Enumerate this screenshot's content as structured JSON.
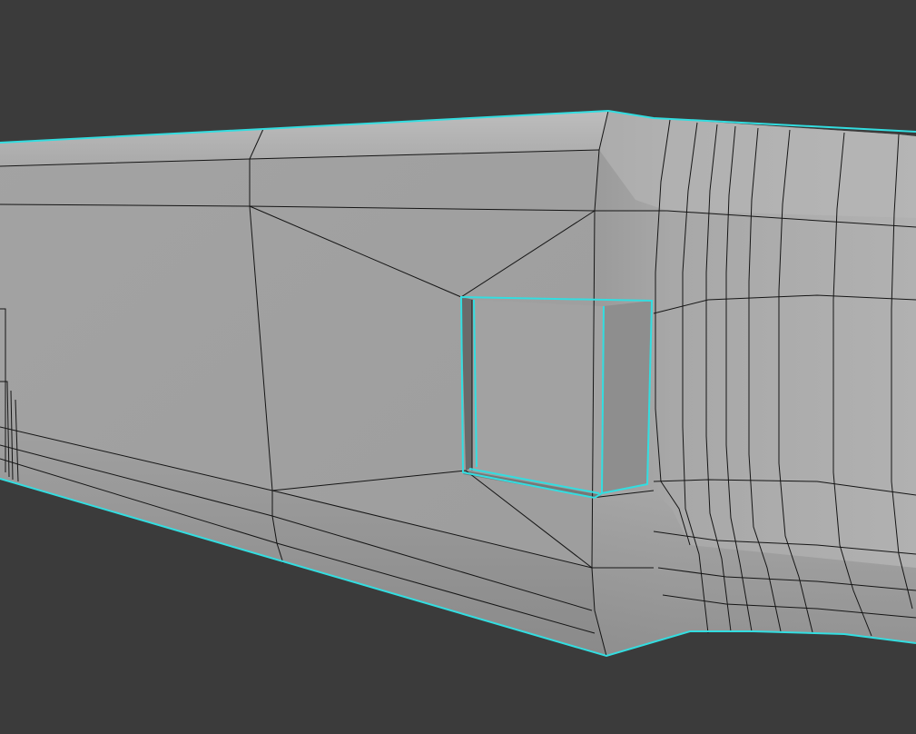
{
  "viewport": {
    "background_color": "#3b3b3b",
    "mesh_color": "#a6a6a6",
    "wire_color": "#151515",
    "selection_color": "#33dde0",
    "cutout_inner_color": "#8e8e8e",
    "cutout_side_color": "#6a6a6a"
  }
}
